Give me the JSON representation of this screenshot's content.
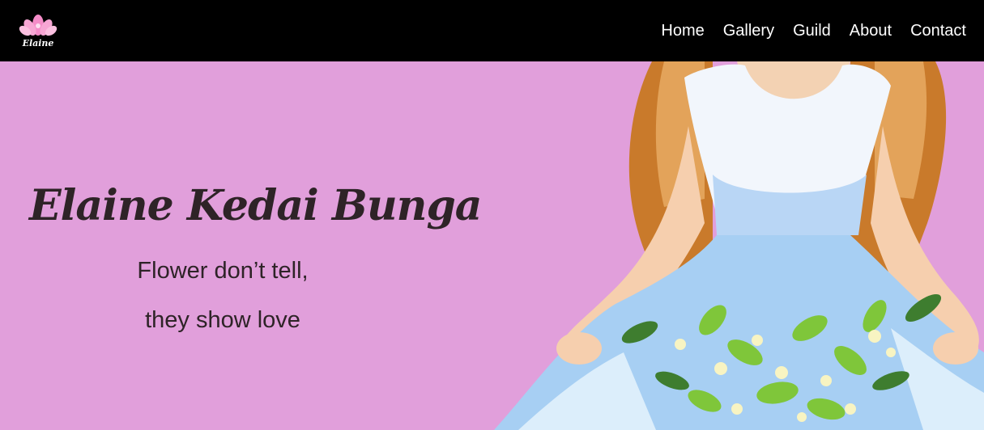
{
  "brand": {
    "logo_text": "Elaine",
    "logo_icon": "lotus-flower-icon",
    "accent": "#f48cc8"
  },
  "nav": {
    "items": [
      {
        "label": "Home"
      },
      {
        "label": "Gallery"
      },
      {
        "label": "Guild"
      },
      {
        "label": "About"
      },
      {
        "label": "Contact"
      }
    ]
  },
  "hero": {
    "title": "Elaine Kedai Bunga",
    "tagline_line1": "Flower don’t tell,",
    "tagline_line2": "they show love",
    "background": "#e19fdb",
    "illustration": "girl-in-dress-holding-flower-bouquet"
  }
}
